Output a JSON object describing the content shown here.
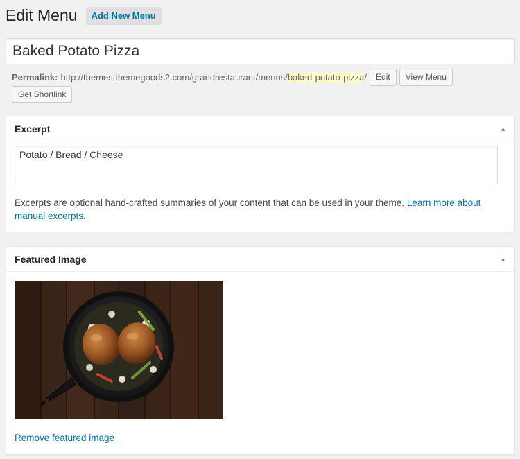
{
  "header": {
    "title": "Edit Menu",
    "add_new": "Add New Menu"
  },
  "post": {
    "title": "Baked Potato Pizza"
  },
  "permalink": {
    "label": "Permalink:",
    "base": "http://themes.themegoods2.com/grandrestaurant/menus/",
    "slug": "baked-potato-pizza",
    "trail": "/",
    "edit_button": "Edit",
    "view_button": "View Menu",
    "shortlink_button": "Get Shortlink"
  },
  "excerpt": {
    "title": "Excerpt",
    "value": "Potato / Bread / Cheese",
    "help": "Excerpts are optional hand-crafted summaries of your content that can be used in your theme.",
    "help_link": "Learn more about manual excerpts."
  },
  "featured": {
    "title": "Featured Image",
    "image_icon": "food-photo",
    "remove_link": "Remove featured image"
  },
  "icons": {
    "toggle": "arrow-up-icon"
  },
  "colors": {
    "link": "#0073aa",
    "slug_highlight": "#fffbcc",
    "background": "#f1f1f1"
  }
}
